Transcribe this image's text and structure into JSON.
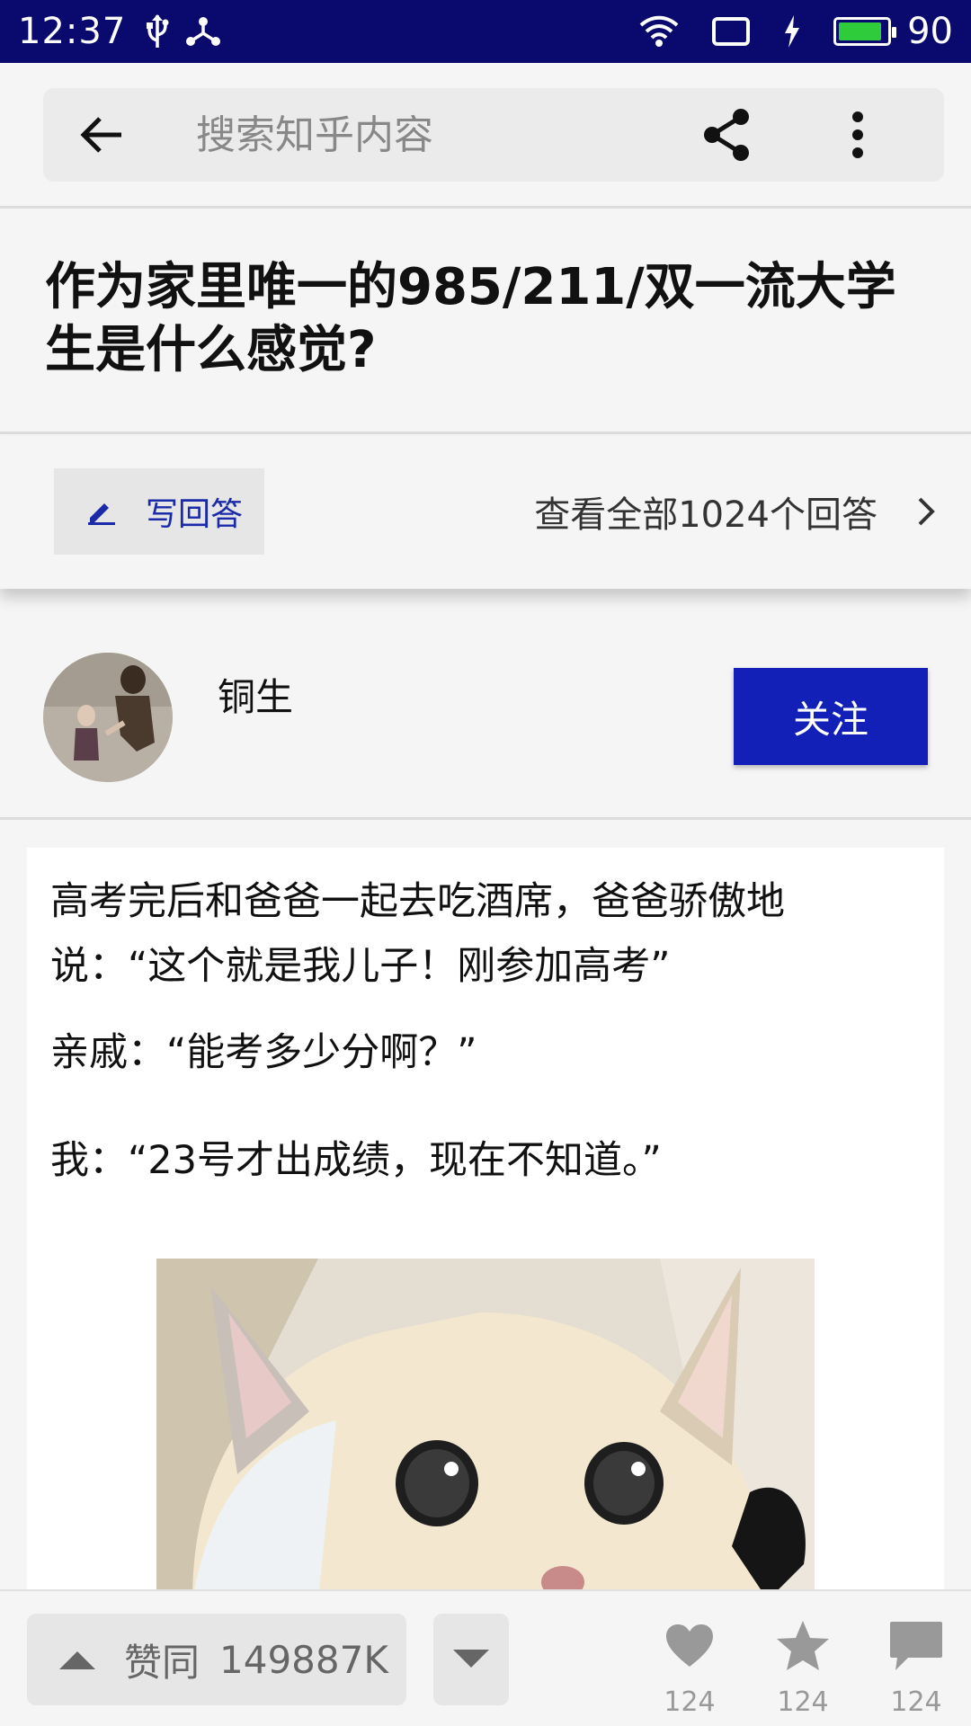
{
  "status_bar": {
    "time": "12:37",
    "battery_level": "90",
    "battery_fill_fraction": 0.9,
    "battery_color": "#2ecc3a",
    "icons": [
      "usb-icon",
      "share-node-icon",
      "wifi-icon",
      "screen-icon",
      "charging-icon",
      "battery-icon"
    ]
  },
  "search": {
    "placeholder": "搜索知乎内容"
  },
  "question": {
    "title": " 作为家里唯一的985/211/双一流大学生是什么感觉?"
  },
  "actions": {
    "write_label": "写回答",
    "view_all_label": "查看全部1024个回答"
  },
  "author": {
    "name": "铜生",
    "follow_label": "关注"
  },
  "content": {
    "paragraphs": [
      "高考完后和爸爸一起去吃酒席，爸爸骄傲地说：“这个就是我儿子！刚参加高考”",
      "亲戚：“能考多少分啊？”",
      "我：“23号才出成绩，现在不知道。”"
    ]
  },
  "bottom_bar": {
    "upvote_label": "赞同",
    "upvote_count": "149887K",
    "likes": "124",
    "favorites": "124",
    "comments": "124"
  },
  "colors": {
    "status_bar_bg": "#0a0a6e",
    "accent_blue": "#1320b8",
    "page_bg": "#f5f5f5"
  }
}
